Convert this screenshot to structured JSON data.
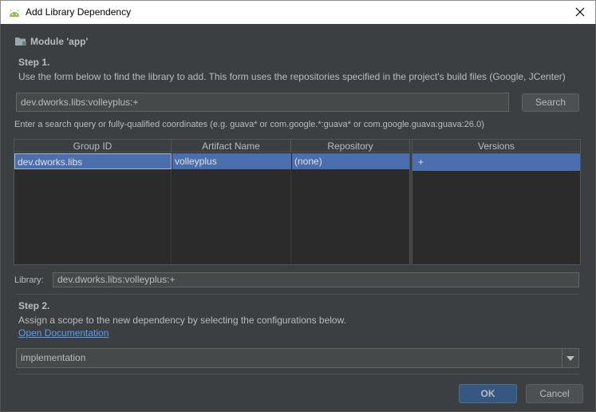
{
  "window": {
    "title": "Add Library Dependency",
    "icon": "android-icon"
  },
  "module": {
    "label": "Module 'app'",
    "icon": "module-folder-icon"
  },
  "step1": {
    "heading": "Step 1.",
    "description": "Use the form below to find the library to add. This form uses the repositories specified in the project's build files (Google, JCenter)",
    "search_value": "dev.dworks.libs:volleyplus:+",
    "search_button": "Search",
    "hint": "Enter a search query or fully-qualified coordinates (e.g. guava* or com.google.*:guava* or com.google.guava:guava:26.0)"
  },
  "results_table": {
    "columns": [
      "Group ID",
      "Artifact Name",
      "Repository"
    ],
    "rows": [
      {
        "group_id": "dev.dworks.libs",
        "artifact": "volleyplus",
        "repository": "(none)"
      }
    ]
  },
  "versions_table": {
    "header": "Versions",
    "rows": [
      "+"
    ]
  },
  "library": {
    "label": "Library:",
    "value": "dev.dworks.libs:volleyplus:+"
  },
  "step2": {
    "heading": "Step 2.",
    "description": "Assign a scope to the new dependency by selecting the configurations below.",
    "doc_link": "Open Documentation",
    "scope_selected": "implementation"
  },
  "footer": {
    "ok": "OK",
    "cancel": "Cancel"
  },
  "colors": {
    "accent": "#4b6eaf",
    "background": "#3c3f41",
    "link": "#589df6"
  }
}
